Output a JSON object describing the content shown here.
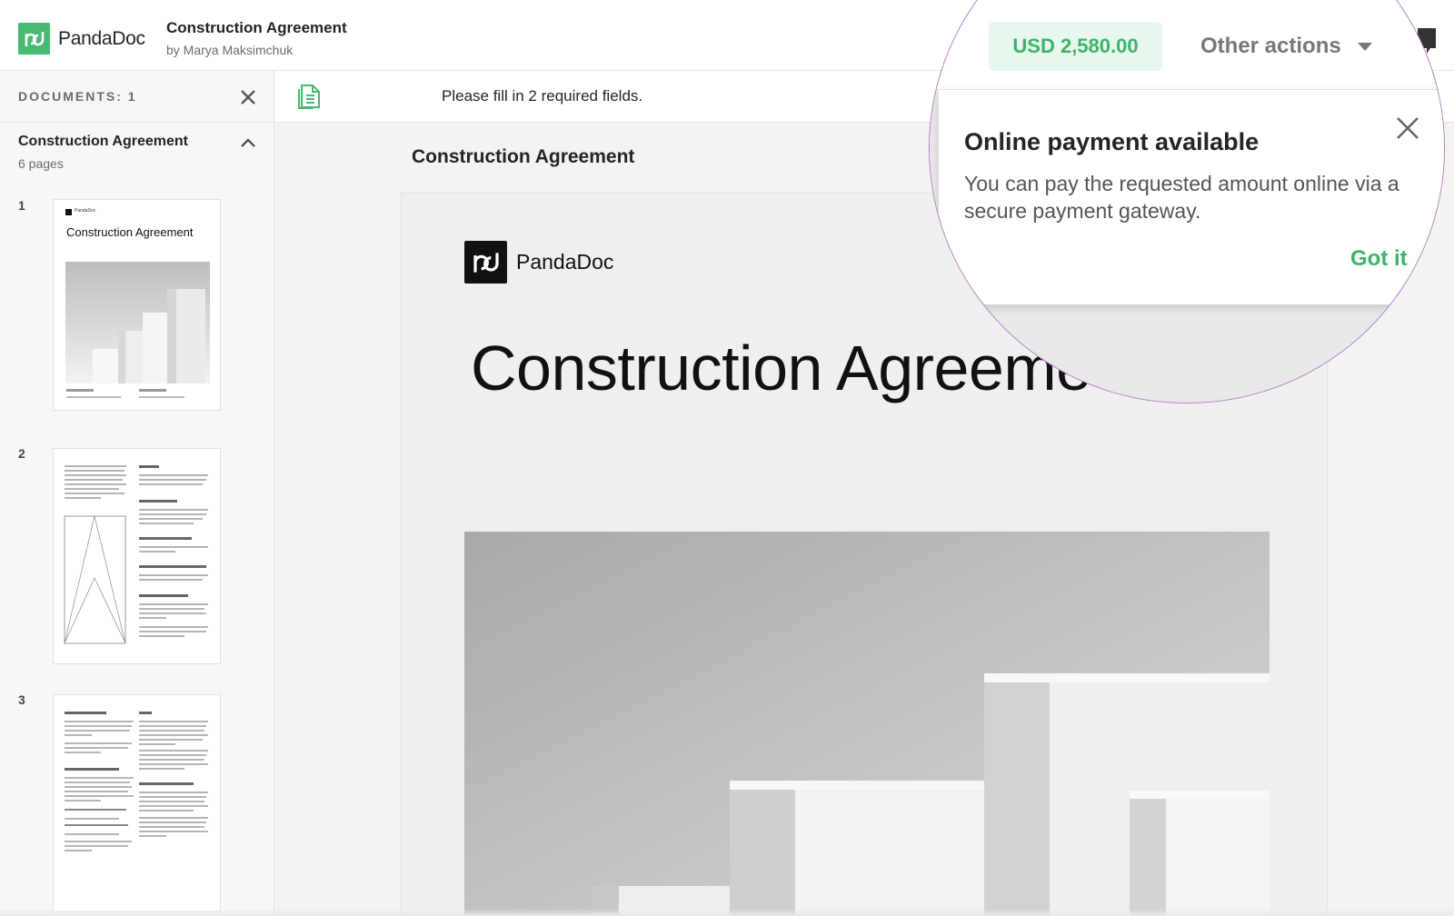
{
  "header": {
    "brand": "PandaDoc",
    "doc_title": "Construction Agreement",
    "doc_author": "by Marya Maksimchuk",
    "price": "USD 2,580.00",
    "other_actions": "Other actions"
  },
  "sidebar": {
    "heading": "DOCUMENTS: 1",
    "doc_title": "Construction Agreement",
    "doc_pages": "6 pages",
    "pages": [
      {
        "num": "1",
        "title": "Construction Agreement",
        "brand": "PandaDoc"
      },
      {
        "num": "2"
      },
      {
        "num": "3"
      }
    ]
  },
  "toolbar": {
    "message": "Please fill in 2 required fields."
  },
  "main": {
    "title": "Construction Agreement",
    "page_brand": "PandaDoc",
    "page_heading": "Construction Agreeme"
  },
  "popup": {
    "title": "Online payment available",
    "body": "You can pay the requested amount online via a secure payment gateway.",
    "action": "Got it"
  },
  "colors": {
    "brand_green": "#47b972",
    "accent_green": "#3bb46a",
    "lens_border": "#b57ac8"
  }
}
